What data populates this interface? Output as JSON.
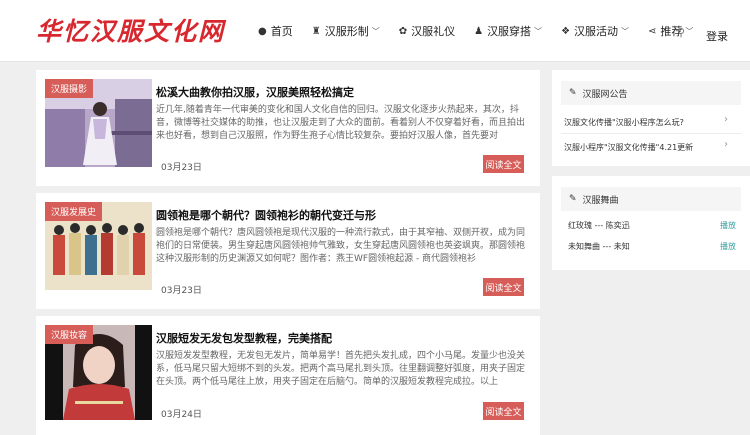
{
  "site": {
    "logo": "华忆汉服文化网"
  },
  "nav": [
    {
      "icon": "●",
      "label": "首页",
      "chevron": ""
    },
    {
      "icon": "♜",
      "label": "汉服形制",
      "chevron": "﹀"
    },
    {
      "icon": "✿",
      "label": "汉服礼仪",
      "chevron": ""
    },
    {
      "icon": "♟",
      "label": "汉服穿搭",
      "chevron": "﹀"
    },
    {
      "icon": "❖",
      "label": "汉服活动",
      "chevron": "﹀"
    },
    {
      "icon": "⋖",
      "label": "推荐",
      "chevron": "﹀"
    }
  ],
  "header": {
    "search_icon": "⚲",
    "login": "登录"
  },
  "common": {
    "read_more": "阅读全文"
  },
  "articles": [
    {
      "tag": "汉服摄影",
      "title": "松溪大曲教你拍汉服，汉服美照轻松搞定",
      "excerpt": "近几年,随着青年一代审美的变化和国人文化自信的回归。汉服文化逐步火热起来，其次，抖音，微博等社交媒体的助推，也让汉服走到了大众的面前。看着别人不仅穿着好看，而且拍出来也好看，想到自己汉服照，作为野生孢子心情比较复杂。要拍好汉服人像，首先要对",
      "date": "03月23日"
    },
    {
      "tag": "汉服发展史",
      "title": "圆领袍是哪个朝代？圆领袍衫的朝代变迁与形",
      "excerpt": "圆领袍是哪个朝代？唐风圆领袍是现代汉服的一种流行款式，由于其窄袖、双侧开衩，成为同袍们的日常便装。男生穿起唐风圆领袍帅气雅致，女生穿起唐风圆领袍也英姿飒爽。那圆领袍这种汉服形制的历史渊源又如何呢？图作者：燕王WF圆领袍起源 - 商代圆领袍衫",
      "date": "03月23日"
    },
    {
      "tag": "汉服妆容",
      "title": "汉服短发无发包发型教程，完美搭配",
      "excerpt": "汉服短发发型教程，无发包无发片，简单易学！首先把头发扎成，四个小马尾。发量少也没关系，低马尾只留大短绑不到的头发。把两个高马尾扎到头顶。往里翻调整好弧度，用夹子固定在头顶。两个低马尾往上放，用夹子固定在后脑勺。简单的汉服短发教程完成拉。以上",
      "date": "03月24日"
    }
  ],
  "sidebar": {
    "notice": {
      "title": "汉服网公告",
      "items": [
        {
          "text": "汉服文化传播\"汉服小程序怎么玩?"
        },
        {
          "text": "汉服小程序\"汉服文化传播\"4.21更新"
        }
      ]
    },
    "music": {
      "title": "汉服舞曲",
      "songs": [
        {
          "text": "红玫瑰  ---  陈奕迅",
          "play": "播放"
        },
        {
          "text": "未知舞曲  ---  未知",
          "play": "播放"
        }
      ]
    }
  },
  "colors": {
    "accent": "#d65d58",
    "logo": "#d8282f",
    "play": "#3a9f9f"
  }
}
